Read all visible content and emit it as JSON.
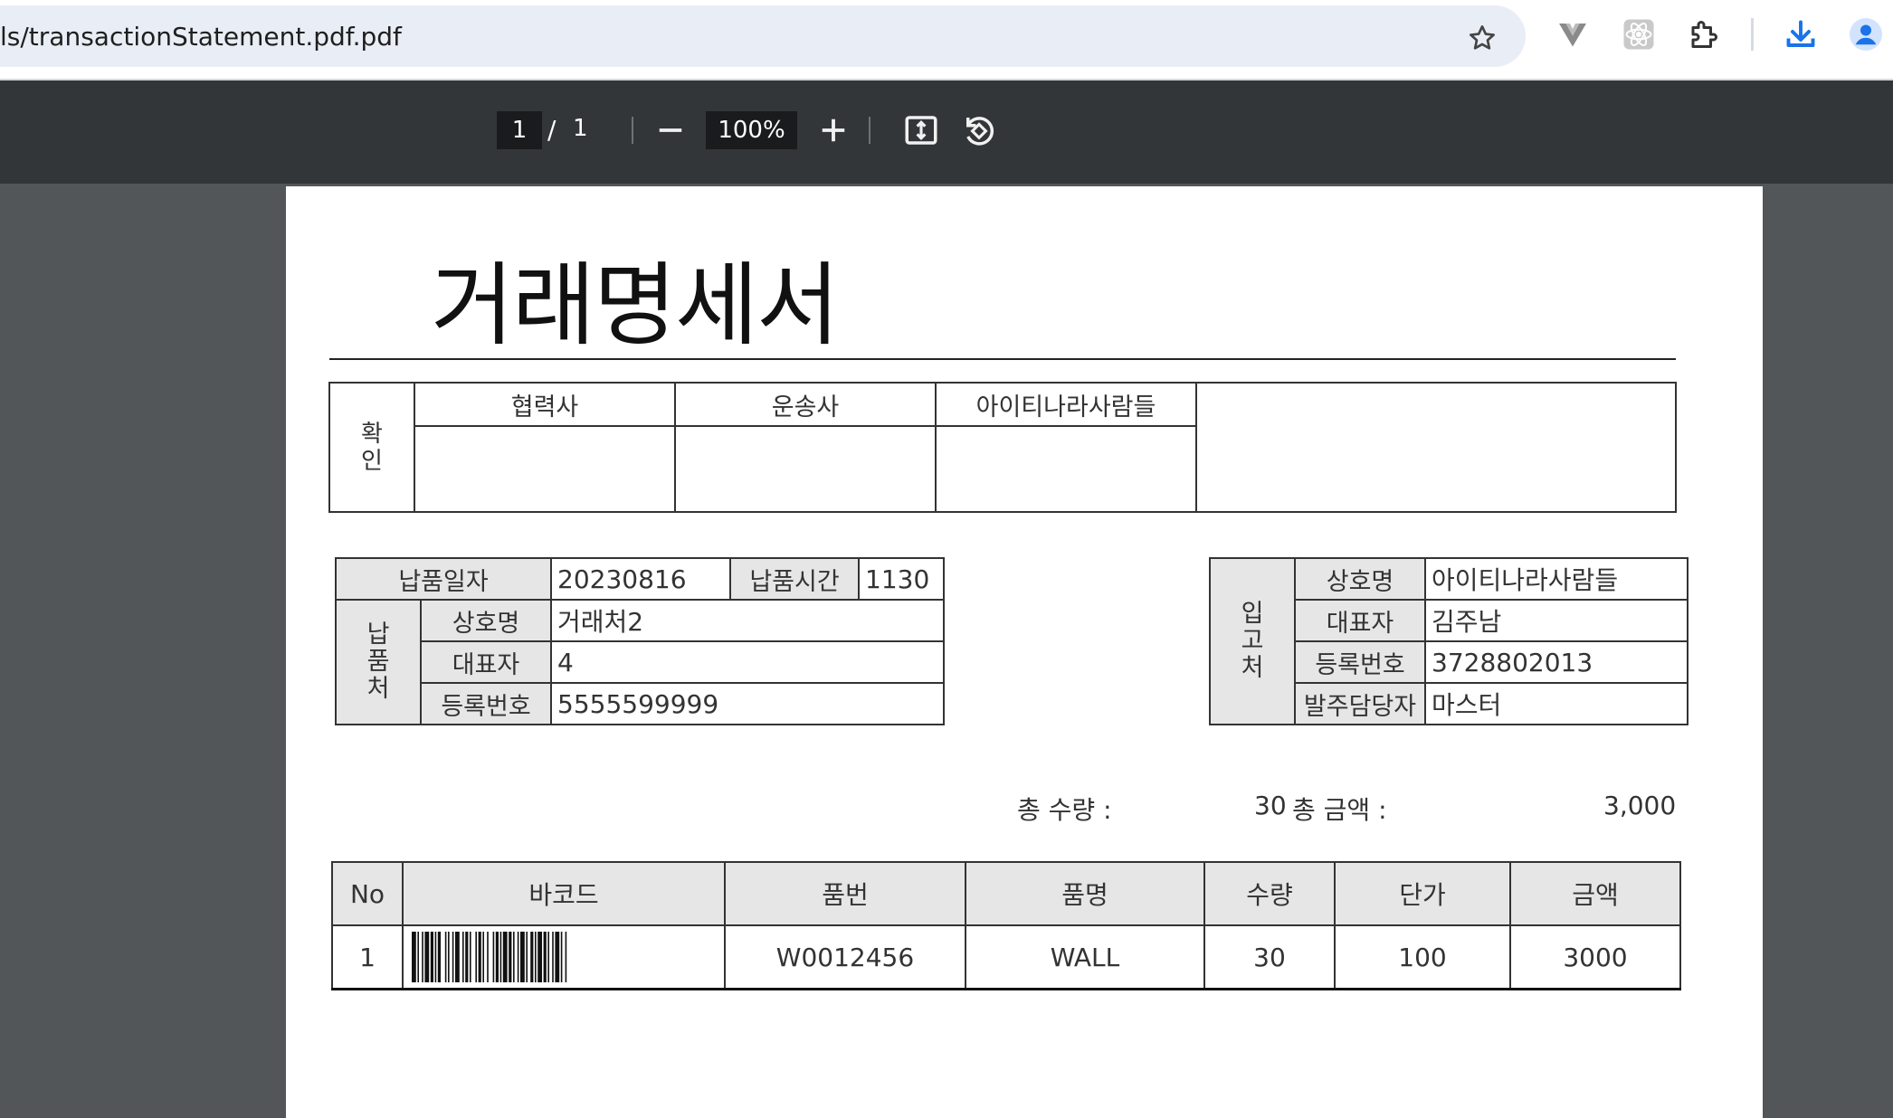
{
  "browser": {
    "url": "ls/transactionStatement.pdf.pdf",
    "icons": [
      "star-icon",
      "vue-devtools-icon",
      "react-devtools-icon",
      "extensions-icon",
      "download-icon",
      "profile-icon"
    ],
    "accent": "#1a73e8"
  },
  "pdf_toolbar": {
    "current_page": "1",
    "separator": "/",
    "total_pages": "1",
    "zoom": "100%",
    "icons": [
      "zoom-out-icon",
      "zoom-in-icon",
      "fit-page-icon",
      "rotate-icon"
    ]
  },
  "document": {
    "title": "거래명세서",
    "confirm": {
      "label": "확\n인",
      "headers": [
        "협력사",
        "운송사",
        "아이티나라사람들",
        ""
      ]
    },
    "supplier": {
      "date_label": "납품일자",
      "date_value": "20230816",
      "time_label": "납품시간",
      "time_value": "1130",
      "side_label": "납\n품\n처",
      "company_label": "상호명",
      "company_value": "거래처2",
      "ceo_label": "대표자",
      "ceo_value": "4",
      "reg_label": "등록번호",
      "reg_value": "5555599999"
    },
    "receiver": {
      "side_label": "입\n고\n처",
      "company_label": "상호명",
      "company_value": "아이티나라사람들",
      "ceo_label": "대표자",
      "ceo_value": "김주남",
      "reg_label": "등록번호",
      "reg_value": "3728802013",
      "manager_label": "발주담당자",
      "manager_value": "마스터"
    },
    "totals": {
      "qty_label": "총 수량 :",
      "qty_value": "30",
      "amount_label": "총 금액 :",
      "amount_value": "3,000"
    },
    "items": {
      "headers": [
        "No",
        "바코드",
        "품번",
        "품명",
        "수량",
        "단가",
        "금액"
      ],
      "rows": [
        {
          "no": "1",
          "part_no": "W0012456",
          "name": "WALL",
          "qty": "30",
          "unit_price": "100",
          "amount": "3000"
        }
      ]
    }
  }
}
